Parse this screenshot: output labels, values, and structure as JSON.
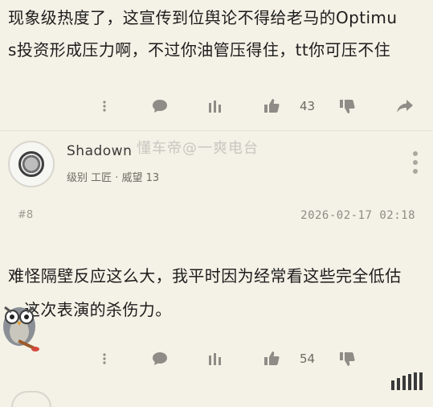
{
  "post": {
    "text_line1": "现象级热度了，这宣传到位舆论不得给老马的Optimu",
    "text_line2": "s投资形成压力啊，不过你油管压得住，tt你可压不住"
  },
  "post_actions": {
    "like_count": "43"
  },
  "comment": {
    "username": "Shadown",
    "meta": "级别 工匠 · 威望 13",
    "floor": "#8",
    "timestamp": "2026-02-17 02:18",
    "text_line1": "难怪隔壁反应这么大，我平时因为经常看这些完全低估",
    "text_line2": "这次表演的杀伤力。"
  },
  "comment_actions": {
    "like_count": "54"
  },
  "watermark": "懂车帝@一爽电台",
  "icons": [
    "comment-icon",
    "reward-icon",
    "thumbs-up-icon",
    "thumbs-down-icon",
    "share-icon",
    "more-icon",
    "signal-icon"
  ],
  "colors": {
    "background": "#f4f1e6",
    "icon_gray": "#8e8c86",
    "text": "#1c1c1c"
  }
}
